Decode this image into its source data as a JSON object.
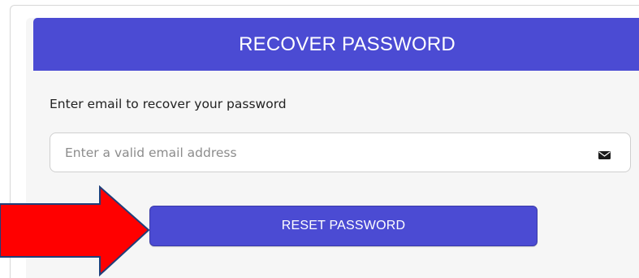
{
  "recover_panel": {
    "title": "RECOVER PASSWORD",
    "instructions": "Enter email to recover your password",
    "email_field": {
      "placeholder": "Enter a valid email address",
      "value": "",
      "icon": "envelope-icon"
    },
    "reset_button_label": "RESET PASSWORD"
  },
  "colors": {
    "header_bg": "#4b4bd3",
    "button_bg": "#4b4bd3",
    "arrow_fill": "#ff0000",
    "arrow_stroke": "#1f3f7a"
  }
}
